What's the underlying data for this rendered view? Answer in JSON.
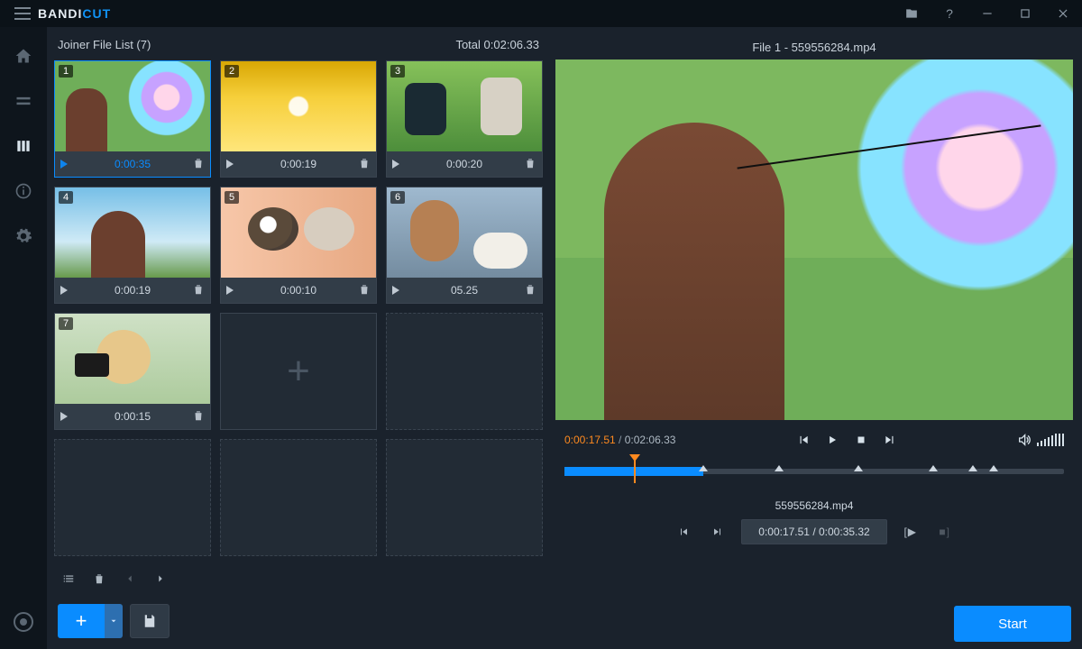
{
  "brand": {
    "part1": "BANDI",
    "part2": "CUT"
  },
  "titlebar": {
    "open": "open-icon",
    "help": "?",
    "min": "–",
    "max": "▢",
    "close": "✕"
  },
  "sidebar": {
    "items": [
      "home",
      "edit",
      "joiner",
      "info",
      "settings"
    ],
    "active_index": 2
  },
  "list": {
    "title": "Joiner File List (7)",
    "total_label": "Total",
    "total_time": "0:02:06.33",
    "clips": [
      {
        "n": "1",
        "dur": "0:00:35",
        "selected": true,
        "img": "img1"
      },
      {
        "n": "2",
        "dur": "0:00:19",
        "selected": false,
        "img": "img2"
      },
      {
        "n": "3",
        "dur": "0:00:20",
        "selected": false,
        "img": "img3"
      },
      {
        "n": "4",
        "dur": "0:00:19",
        "selected": false,
        "img": "img4"
      },
      {
        "n": "5",
        "dur": "0:00:10",
        "selected": false,
        "img": "img5"
      },
      {
        "n": "6",
        "dur": "05.25",
        "selected": false,
        "img": "img6"
      },
      {
        "n": "7",
        "dur": "0:00:15",
        "selected": false,
        "img": "img7"
      }
    ]
  },
  "preview": {
    "title": "File 1 - 559556284.mp4",
    "current": "0:00:17.51",
    "total": "0:02:06.33",
    "filename": "559556284.mp4",
    "seg_current": "0:00:17.51",
    "seg_total": "0:00:35.32"
  },
  "timeline": {
    "segments_pct": [
      0,
      27.8,
      42.9,
      58.8,
      73.9,
      81.8,
      86.0,
      100
    ],
    "playhead_pct": 13.9
  },
  "buttons": {
    "start": "Start"
  }
}
